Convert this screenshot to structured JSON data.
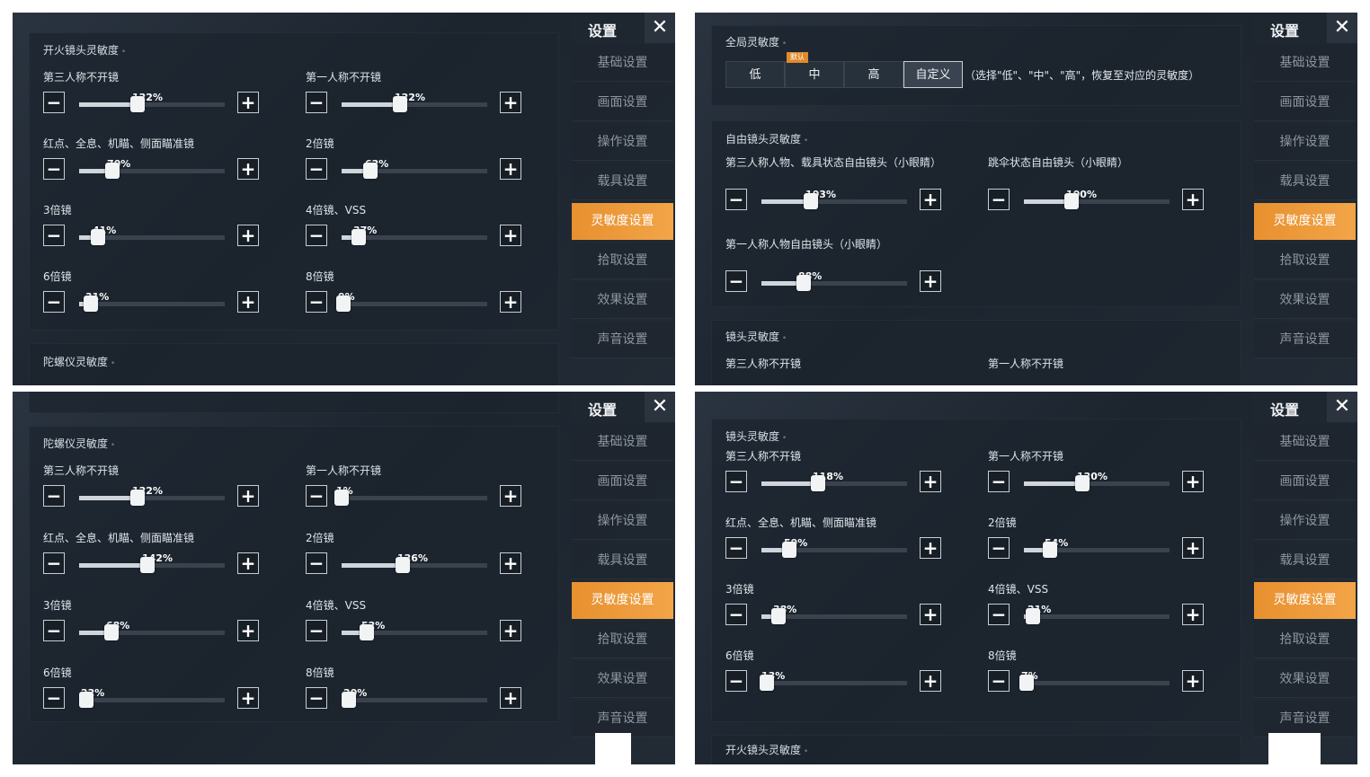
{
  "sidebar": {
    "title": "设置",
    "close": "✕",
    "items": [
      "基础设置",
      "画面设置",
      "操作设置",
      "载具设置",
      "灵敏度设置",
      "拾取设置",
      "效果设置",
      "声音设置"
    ],
    "active_index": 4
  },
  "colors": {
    "accent": "#f0a040",
    "background": "#1f2832"
  },
  "icons": {
    "minus": "−",
    "plus": "+"
  },
  "panel1": {
    "section_title": "开火镜头灵敏度",
    "next_section_title": "陀螺仪灵敏度",
    "sliders": [
      {
        "label": "第三人称不开镜",
        "value": "122%",
        "level": 0.4
      },
      {
        "label": "第一人称不开镜",
        "value": "122%",
        "level": 0.4
      },
      {
        "label": "红点、全息、机瞄、侧面瞄准镜",
        "value": "70%",
        "level": 0.23
      },
      {
        "label": "2倍镜",
        "value": "62%",
        "level": 0.2
      },
      {
        "label": "3倍镜",
        "value": "41%",
        "level": 0.13
      },
      {
        "label": "4倍镜、VSS",
        "value": "37%",
        "level": 0.12
      },
      {
        "label": "6倍镜",
        "value": "31%",
        "level": 0.08
      },
      {
        "label": "8倍镜",
        "value": "9%",
        "level": 0.01
      }
    ]
  },
  "panel2": {
    "global_title": "全局灵敏度",
    "presets": [
      "低",
      "中",
      "高",
      "自定义"
    ],
    "default_badge": "默认",
    "hint": "（选择\"低\"、\"中\"、\"高\"，恢复至对应的灵敏度）",
    "free_title": "自由镜头灵敏度",
    "free_sliders": [
      {
        "label": "第三人称人物、载具状态自由镜头（小眼睛）",
        "value": "103%",
        "level": 0.34
      },
      {
        "label": "跳伞状态自由镜头（小眼睛）",
        "value": "100%",
        "level": 0.33
      },
      {
        "label": "第一人称人物自由镜头（小眼睛）",
        "value": "88%",
        "level": 0.29
      }
    ],
    "lens_title": "镜头灵敏度",
    "lens_labels": [
      "第三人称不开镜",
      "第一人称不开镜"
    ]
  },
  "panel3": {
    "section_title": "陀螺仪灵敏度",
    "sliders": [
      {
        "label": "第三人称不开镜",
        "value": "122%",
        "level": 0.4
      },
      {
        "label": "第一人称不开镜",
        "value": "1%",
        "level": 0.0
      },
      {
        "label": "红点、全息、机瞄、侧面瞄准镜",
        "value": "142%",
        "level": 0.47
      },
      {
        "label": "2倍镜",
        "value": "126%",
        "level": 0.42
      },
      {
        "label": "3倍镜",
        "value": "68%",
        "level": 0.22
      },
      {
        "label": "4倍镜、VSS",
        "value": "52%",
        "level": 0.17
      },
      {
        "label": "6倍镜",
        "value": "22%",
        "level": 0.05
      },
      {
        "label": "8倍镜",
        "value": "20%",
        "level": 0.05
      }
    ]
  },
  "panel4": {
    "section_title": "镜头灵敏度",
    "next_section_title": "开火镜头灵敏度",
    "sliders": [
      {
        "label": "第三人称不开镜",
        "value": "118%",
        "level": 0.39
      },
      {
        "label": "第一人称不开镜",
        "value": "120%",
        "level": 0.4
      },
      {
        "label": "红点、全息、机瞄、侧面瞄准镜",
        "value": "59%",
        "level": 0.19
      },
      {
        "label": "2倍镜",
        "value": "54%",
        "level": 0.18
      },
      {
        "label": "3倍镜",
        "value": "38%",
        "level": 0.12
      },
      {
        "label": "4倍镜、VSS",
        "value": "21%",
        "level": 0.06
      },
      {
        "label": "6倍镜",
        "value": "13%",
        "level": 0.04
      },
      {
        "label": "8倍镜",
        "value": "7%",
        "level": 0.02
      }
    ]
  }
}
